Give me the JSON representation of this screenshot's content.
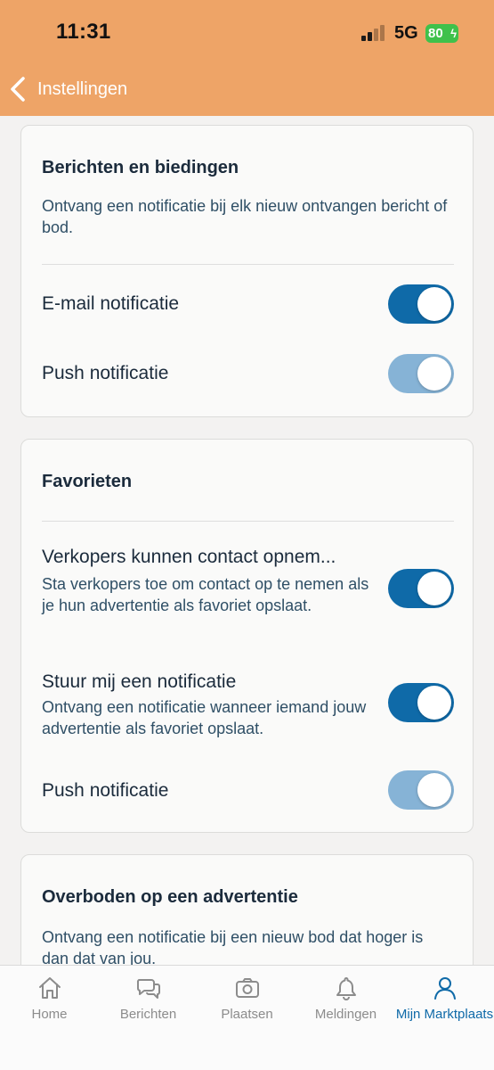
{
  "status_bar": {
    "time": "11:31",
    "network": "5G",
    "battery": "80"
  },
  "header": {
    "back_label": "Instellingen"
  },
  "sections": {
    "berichten": {
      "title": "Berichten en biedingen",
      "description": "Ontvang een notificatie bij elk nieuw ontvangen bericht of bod.",
      "email_label": "E-mail notificatie",
      "email_on": true,
      "push_label": "Push notificatie",
      "push_on": true
    },
    "favorieten": {
      "title": "Favorieten",
      "contact_label": "Verkopers kunnen contact opnem...",
      "contact_sub": "Sta verkopers toe om contact op te nemen als je hun advertentie als favoriet opslaat.",
      "contact_on": true,
      "notify_label": "Stuur mij een notificatie",
      "notify_sub": "Ontvang een notificatie wanneer iemand jouw advertentie als favoriet opslaat.",
      "notify_on": true,
      "push_label": "Push notificatie",
      "push_on": true
    },
    "overboden": {
      "title": "Overboden op een advertentie",
      "description": "Ontvang een notificatie bij een nieuw bod dat hoger is dan dat van jou."
    }
  },
  "tabbar": {
    "home": "Home",
    "berichten": "Berichten",
    "plaatsen": "Plaatsen",
    "meldingen": "Meldingen",
    "mijn": "Mijn Marktplaats"
  },
  "colors": {
    "header": "#eea467",
    "toggle_on": "#0f6aa8",
    "toggle_disabled": "#86b3d6",
    "active_tab": "#0f6aa8"
  }
}
